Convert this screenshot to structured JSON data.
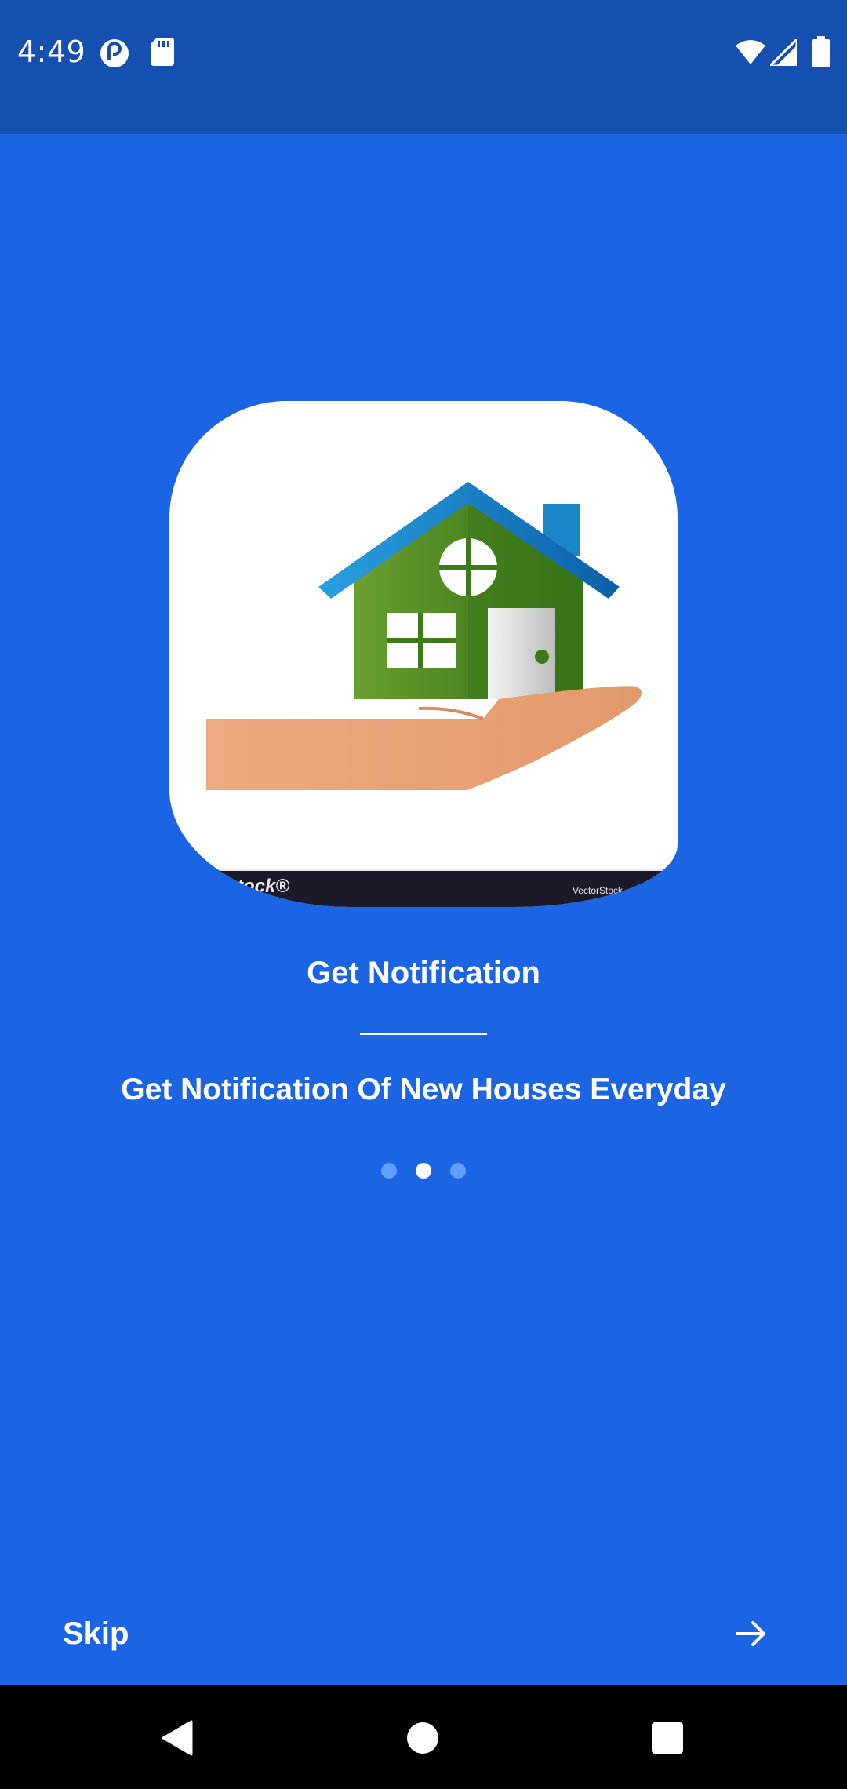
{
  "status_bar": {
    "time": "4:49",
    "icons": [
      "pocket-casts-icon",
      "sd-card-icon",
      "wifi-icon",
      "signal-icon",
      "battery-icon"
    ],
    "background": "#1550b0"
  },
  "onboarding": {
    "background": "#1b65e4",
    "illustration": {
      "icon": "house-in-hand-icon",
      "watermark_left": "tock®",
      "watermark_right": "VectorStock"
    },
    "title": "Get Notification",
    "subtitle": "Get Notification Of New Houses Everyday",
    "page_indicator": {
      "total": 3,
      "current": 2
    }
  },
  "footer": {
    "skip_label": "Skip",
    "next_icon": "arrow-right-icon"
  },
  "nav_bar": {
    "icons": [
      "back-icon",
      "home-icon",
      "recents-icon"
    ]
  }
}
